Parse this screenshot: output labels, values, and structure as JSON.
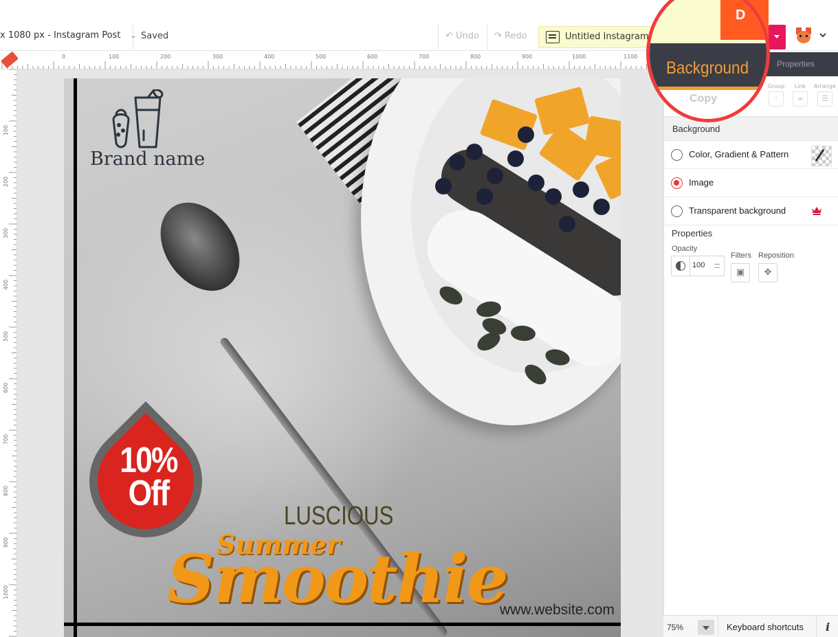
{
  "toolbar": {
    "size_label": "x 1080 px - Instagram Post",
    "saved": "Saved",
    "undo": "Undo",
    "redo": "Redo",
    "doc_title": "Untitled Instagram Po",
    "download_label": "D"
  },
  "ruler": {
    "h_ticks": [
      "0",
      "100",
      "200",
      "300",
      "400",
      "500",
      "600",
      "700",
      "800",
      "900",
      "1000",
      "1100"
    ],
    "v_ticks": [
      "100",
      "200",
      "300",
      "400",
      "500",
      "600",
      "700",
      "800",
      "900",
      "1000"
    ]
  },
  "canvas": {
    "brand_name": "Brand name",
    "badge_line1": "10%",
    "badge_line2": "Off",
    "headline_small": "LUSCIOUS",
    "headline_script": "Summer",
    "headline_big": "Smoothie",
    "website": "www.website.com"
  },
  "panel": {
    "tab_background": "Background",
    "tab_properties": "Properties",
    "tools": [
      {
        "label": "Group"
      },
      {
        "label": "Link"
      },
      {
        "label": "Arrange"
      }
    ],
    "copy_label": "Copy",
    "section_title": "Background",
    "options": [
      {
        "label": "Color, Gradient & Pattern",
        "selected": false
      },
      {
        "label": "Image",
        "selected": true
      },
      {
        "label": "Transparent background",
        "selected": false
      }
    ],
    "properties_title": "Properties",
    "opacity_label": "Opacity",
    "opacity_value": "100",
    "filters_label": "Filters",
    "reposition_label": "Reposition"
  },
  "statusbar": {
    "zoom": "75%",
    "keyboard_shortcuts": "Keyboard shortcuts",
    "info": "i"
  },
  "colors": {
    "accent_orange": "#ff5a1f",
    "accent_pink": "#e8175d",
    "tab_dark": "#3a3d45",
    "tab_highlight": "#f59b35",
    "radio_selected": "#e8353a",
    "highlight_ring": "#f03c3c"
  }
}
